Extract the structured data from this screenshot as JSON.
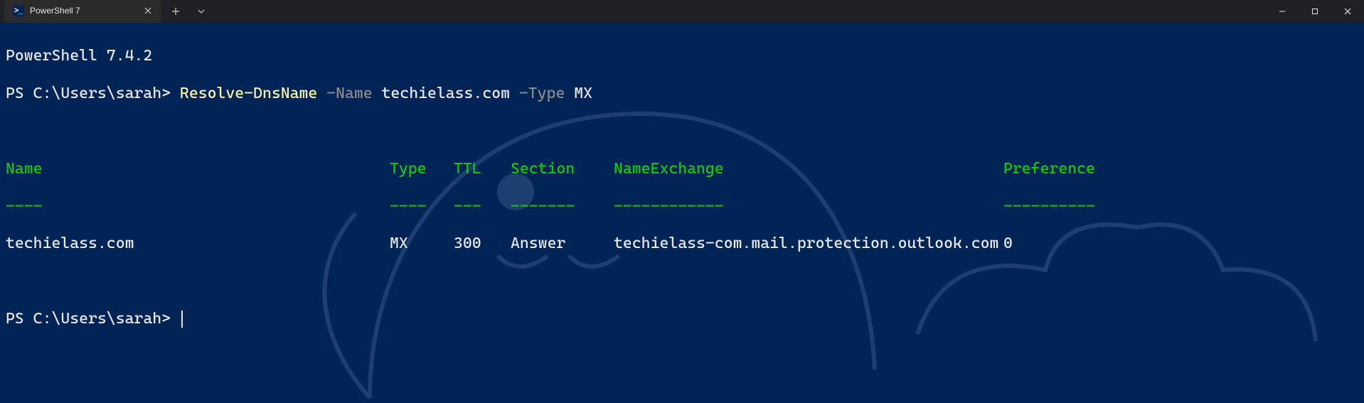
{
  "titlebar": {
    "tab_title": "PowerShell 7"
  },
  "terminal": {
    "version_line": "PowerShell 7.4.2",
    "prompt": "PS C:\\Users\\sarah>",
    "cmd": {
      "name": "Resolve-DnsName",
      "param1": "-Name",
      "arg1": "techielass.com",
      "param2": "-Type",
      "arg2": "MX"
    },
    "table": {
      "headers": {
        "name": "Name",
        "type": "Type",
        "ttl": "TTL",
        "section": "Section",
        "nameexchange": "NameExchange",
        "preference": "Preference"
      },
      "dividers": {
        "name": "----",
        "type": "----",
        "ttl": "---",
        "section": "-------",
        "nameexchange": "------------",
        "preference": "----------"
      },
      "row": {
        "name": "techielass.com",
        "type": "MX",
        "ttl": "300",
        "section": "Answer",
        "nameexchange": "techielass-com.mail.protection.outlook.com",
        "preference": "0"
      }
    }
  }
}
